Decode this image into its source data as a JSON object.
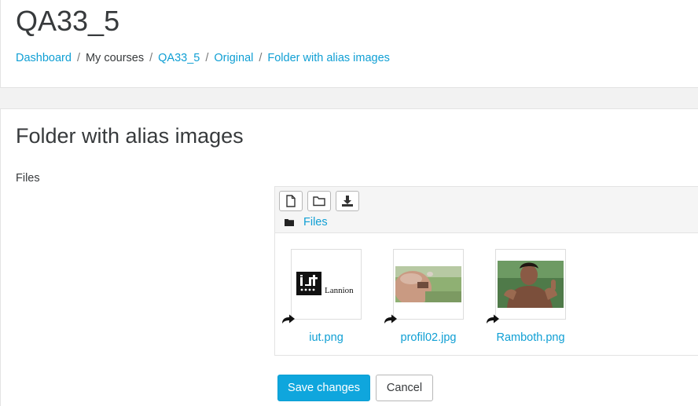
{
  "header": {
    "title": "QA33_5",
    "breadcrumb": [
      "Dashboard",
      "My courses",
      "QA33_5",
      "Original",
      "Folder with alias images"
    ]
  },
  "main": {
    "section_title": "Folder with alias images",
    "files_label": "Files",
    "file_manager": {
      "toolbar": {
        "add_icon": "file-add-icon",
        "folder_icon": "folder-create-icon",
        "download_icon": "download-icon"
      },
      "path_label": "Files",
      "files": [
        {
          "name": "iut.png",
          "thumb_text": "Lannion"
        },
        {
          "name": "profil02.jpg"
        },
        {
          "name": "Ramboth.png"
        }
      ]
    },
    "buttons": {
      "save": "Save changes",
      "cancel": "Cancel"
    }
  },
  "colors": {
    "link": "#0f9fd4",
    "primary": "#0fa6dd"
  }
}
